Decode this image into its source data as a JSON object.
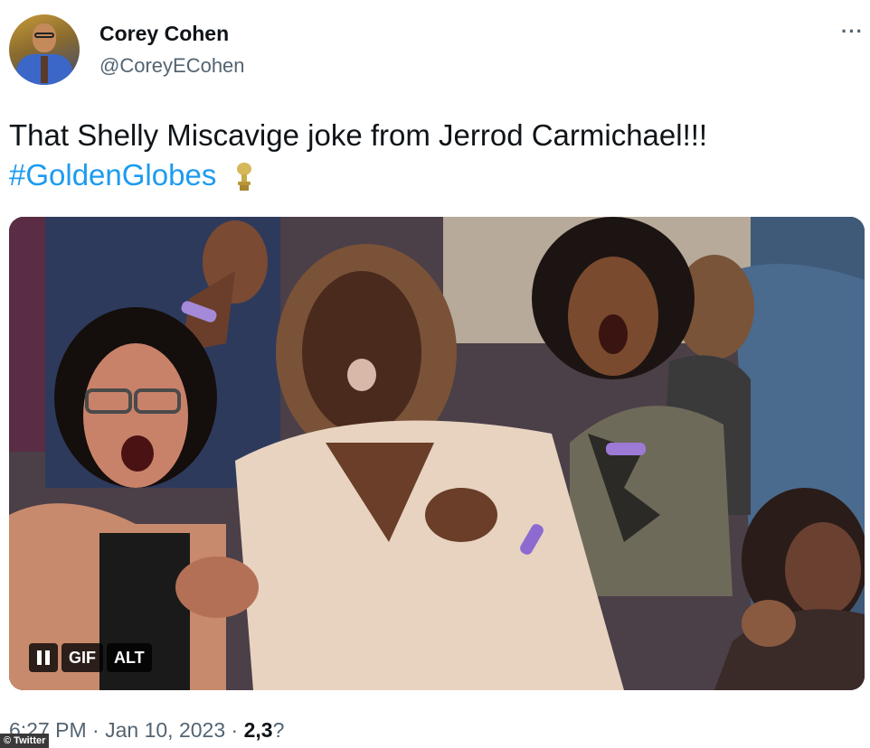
{
  "author": {
    "name": "Corey Cohen",
    "handle": "@CoreyECohen"
  },
  "more_menu_label": "···",
  "tweet": {
    "text_line1": "That Shelly Miscavige joke from Jerrod Carmichael!!!",
    "hashtag": "#GoldenGlobes",
    "emoji": "trophy-icon"
  },
  "media": {
    "gif_label": "GIF",
    "alt_label": "ALT"
  },
  "meta": {
    "time": "6:27 PM",
    "separator": "·",
    "date": "Jan 10, 2023",
    "views_count": "2,3",
    "views_partial": "?"
  },
  "watermark": "© Twitter",
  "colors": {
    "link": "#1d9bf0",
    "secondary_text": "#536471",
    "primary_text": "#0f1419"
  }
}
